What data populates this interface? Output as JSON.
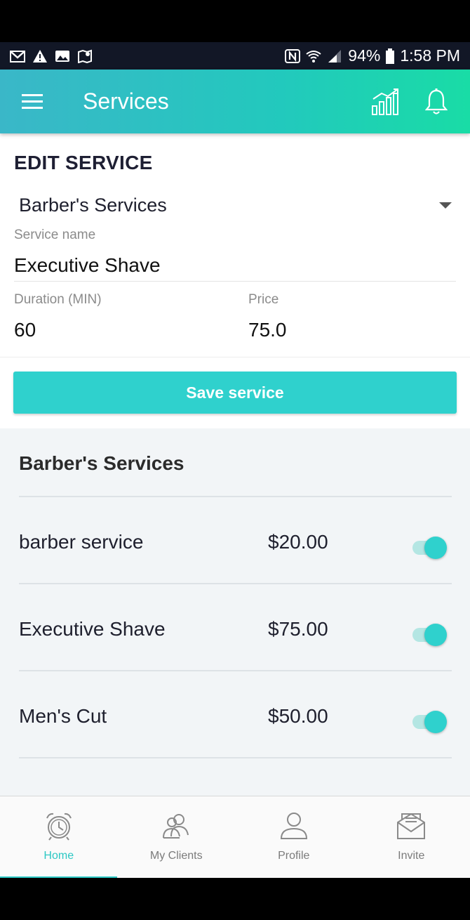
{
  "status_bar": {
    "battery": "94%",
    "time": "1:58 PM",
    "left_icons": [
      "gmail-icon",
      "warning-icon",
      "image-icon",
      "maps-icon"
    ],
    "right_icons": [
      "nfc-icon",
      "wifi-icon",
      "signal-icon",
      "battery-icon"
    ]
  },
  "app_bar": {
    "title": "Services",
    "menu_icon": "menu-icon",
    "actions": [
      "chart-icon",
      "bell-icon"
    ]
  },
  "edit_form": {
    "heading": "EDIT SERVICE",
    "category": "Barber's Services",
    "service_name_label": "Service name",
    "service_name_value": "Executive Shave",
    "duration_label": "Duration (MIN)",
    "duration_value": "60",
    "price_label": "Price",
    "price_value": "75.0",
    "save_label": "Save service"
  },
  "service_list": {
    "heading": "Barber's Services",
    "items": [
      {
        "name": "barber service",
        "price": "$20.00",
        "enabled": true
      },
      {
        "name": "Executive Shave",
        "price": "$75.00",
        "enabled": true
      },
      {
        "name": "Men's Cut",
        "price": "$50.00",
        "enabled": true
      }
    ]
  },
  "bottom_nav": {
    "items": [
      {
        "label": "Home",
        "icon": "alarm-clock-icon",
        "active": true
      },
      {
        "label": "My Clients",
        "icon": "clients-icon",
        "active": false
      },
      {
        "label": "Profile",
        "icon": "profile-icon",
        "active": false
      },
      {
        "label": "Invite",
        "icon": "envelope-icon",
        "active": false
      }
    ]
  },
  "colors": {
    "accent": "#2fd1cd",
    "app_bar_start": "#3ab7c8",
    "app_bar_end": "#19dca6",
    "status_bar": "#121726"
  }
}
